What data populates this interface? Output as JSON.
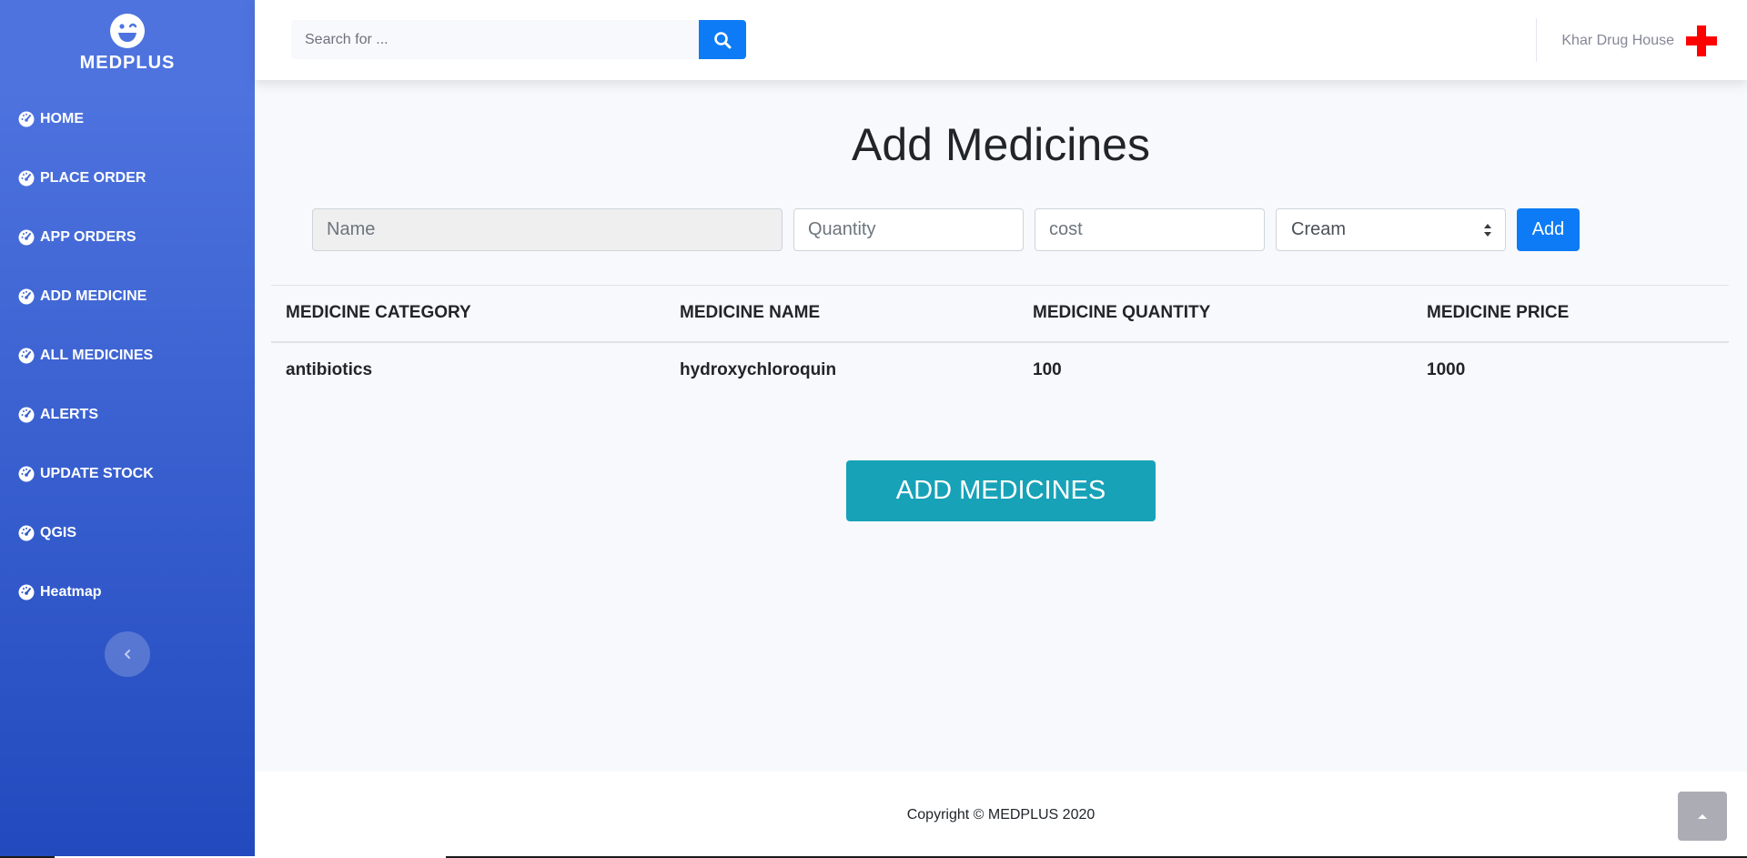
{
  "brand": {
    "name": "MEDPLUS",
    "icon": "laugh-wink-icon"
  },
  "sidebar": {
    "items": [
      {
        "label": "HOME",
        "icon": "tachometer-icon"
      },
      {
        "label": "PLACE ORDER",
        "icon": "tachometer-icon"
      },
      {
        "label": "APP ORDERS",
        "icon": "tachometer-icon"
      },
      {
        "label": "ADD MEDICINE",
        "icon": "tachometer-icon"
      },
      {
        "label": "ALL MEDICINES",
        "icon": "tachometer-icon"
      },
      {
        "label": "ALERTS",
        "icon": "tachometer-icon"
      },
      {
        "label": "UPDATE STOCK",
        "icon": "tachometer-icon"
      },
      {
        "label": "QGIS",
        "icon": "tachometer-icon"
      },
      {
        "label": "Heatmap",
        "icon": "tachometer-icon"
      }
    ],
    "toggle_icon": "chevron-left-icon"
  },
  "topbar": {
    "search_placeholder": "Search for ...",
    "search_icon": "search-icon",
    "user_name": "Khar Drug House",
    "user_icon": "red-cross-icon"
  },
  "main": {
    "title": "Add Medicines",
    "form": {
      "name_placeholder": "Name",
      "quantity_placeholder": "Quantity",
      "cost_placeholder": "cost",
      "category_selected": "Cream",
      "add_label": "Add"
    },
    "table": {
      "headers": [
        "MEDICINE CATEGORY",
        "MEDICINE NAME",
        "MEDICINE QUANTITY",
        "MEDICINE PRICE"
      ],
      "rows": [
        [
          "antibiotics",
          "hydroxychloroquin",
          "100",
          "1000"
        ]
      ]
    },
    "submit_label": "ADD MEDICINES"
  },
  "footer": {
    "copyright": "Copyright © MEDPLUS 2020",
    "scroll_top_icon": "angle-up-icon"
  },
  "colors": {
    "sidebar_top": "#4e73df",
    "sidebar_bottom": "#224abe",
    "primary": "#0d7bf5",
    "info": "#17a2b8",
    "cross": "#ff0000"
  }
}
